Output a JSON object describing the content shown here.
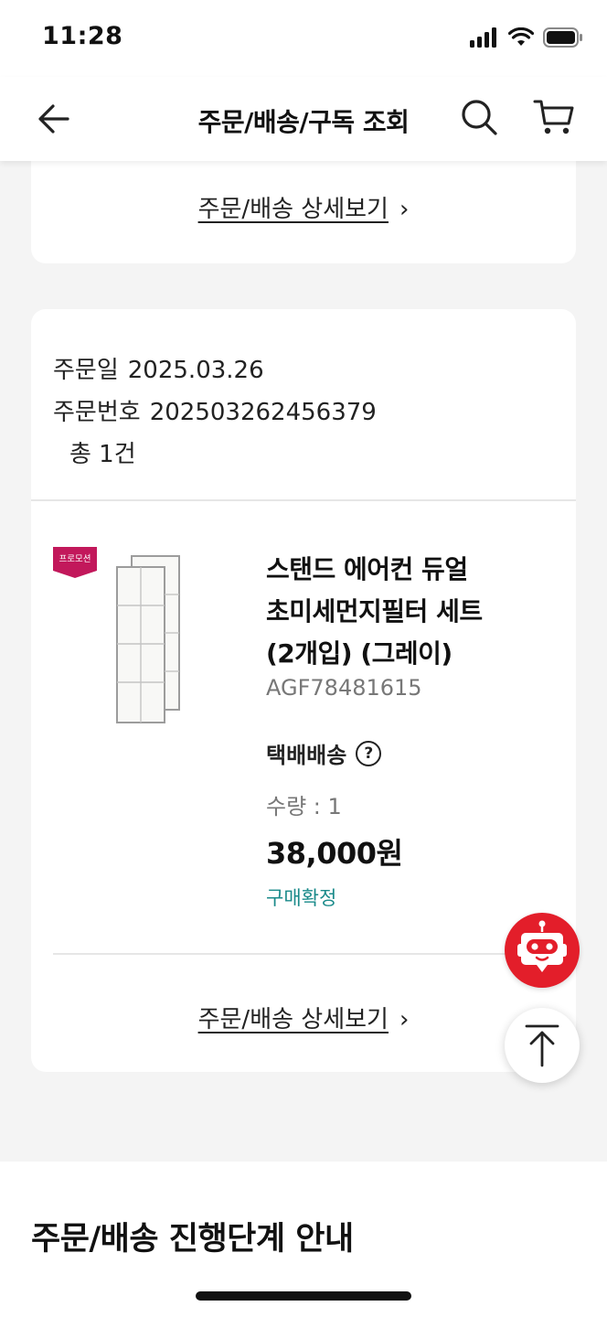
{
  "status_bar": {
    "time": "11:28"
  },
  "header": {
    "title": "주문/배송/구독 조회"
  },
  "top_card": {
    "detail_link": "주문/배송 상세보기"
  },
  "order": {
    "date_label": "주문일",
    "date_value": "2025.03.26",
    "number_label": "주문번호",
    "number_value": "202503262456379",
    "count_text": "총 1건",
    "promo_badge": "프로모션",
    "product": {
      "name_line1": "스탠드 에어컨 듀얼",
      "name_line2": "초미세먼지필터 세트",
      "name_line3": "(2개입) (그레이)",
      "code": "AGF78481615",
      "shipping_method": "택배배송",
      "help_symbol": "?",
      "quantity": "수량 : 1",
      "price": "38,000원",
      "status": "구매확정"
    },
    "detail_link": "주문/배송 상세보기"
  },
  "guide_section": {
    "title": "주문/배송 진행단계 안내"
  },
  "colors": {
    "accent_red": "#e31e2a",
    "status_teal": "#1a8a8a",
    "promo_badge": "#c2185b"
  }
}
